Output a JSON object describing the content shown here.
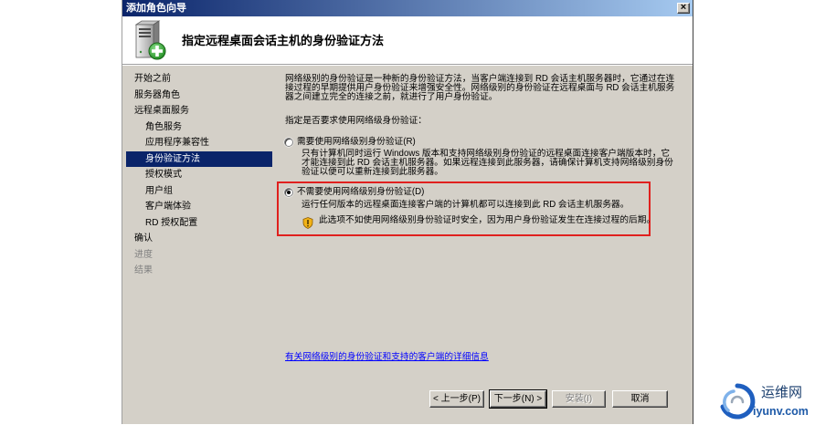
{
  "window": {
    "title": "添加角色向导",
    "close_glyph": "×"
  },
  "header": {
    "title": "指定远程桌面会话主机的身份验证方法",
    "icon": "server-add-icon"
  },
  "nav": {
    "items": [
      {
        "label": "开始之前",
        "level": 0,
        "selected": false,
        "enabled": true
      },
      {
        "label": "服务器角色",
        "level": 0,
        "selected": false,
        "enabled": true
      },
      {
        "label": "远程桌面服务",
        "level": 0,
        "selected": false,
        "enabled": true
      },
      {
        "label": "角色服务",
        "level": 1,
        "selected": false,
        "enabled": true
      },
      {
        "label": "应用程序兼容性",
        "level": 1,
        "selected": false,
        "enabled": true
      },
      {
        "label": "身份验证方法",
        "level": 1,
        "selected": true,
        "enabled": true
      },
      {
        "label": "授权模式",
        "level": 1,
        "selected": false,
        "enabled": true
      },
      {
        "label": "用户组",
        "level": 1,
        "selected": false,
        "enabled": true
      },
      {
        "label": "客户端体验",
        "level": 1,
        "selected": false,
        "enabled": true
      },
      {
        "label": "RD 授权配置",
        "level": 1,
        "selected": false,
        "enabled": true
      },
      {
        "label": "确认",
        "level": 0,
        "selected": false,
        "enabled": true
      },
      {
        "label": "进度",
        "level": 0,
        "selected": false,
        "enabled": false
      },
      {
        "label": "结果",
        "level": 0,
        "selected": false,
        "enabled": false
      }
    ]
  },
  "content": {
    "intro": "网络级别的身份验证是一种新的身份验证方法，当客户端连接到 RD 会话主机服务器时，它通过在连接过程的早期提供用户身份验证来增强安全性。网络级别的身份验证在远程桌面与 RD 会话主机服务器之间建立完全的连接之前，就进行了用户身份验证。",
    "prompt": "指定是否要求使用网络级身份验证：",
    "options": [
      {
        "label": "需要使用网络级别身份验证(R)",
        "description": "只有计算机同时运行 Windows 版本和支持网络级别身份验证的远程桌面连接客户端版本时，它才能连接到此 RD 会话主机服务器。如果远程连接到此服务器，请确保计算机支持网络级别身份验证以便可以重新连接到此服务器。",
        "checked": false,
        "highlighted": false
      },
      {
        "label": "不需要使用网络级别身份验证(D)",
        "description": "运行任何版本的远程桌面连接客户端的计算机都可以连接到此 RD 会话主机服务器。",
        "checked": true,
        "highlighted": true,
        "warning_icon": "shield-warning-icon",
        "warning": "此选项不如使用网络级别身份验证时安全，因为用户身份验证发生在连接过程的后期。"
      }
    ],
    "more_info_link": "有关网络级别的身份验证和支持的客户端的详细信息"
  },
  "buttons": {
    "back": {
      "label": "< 上一步(P)",
      "enabled": true,
      "default": false
    },
    "next": {
      "label": "下一步(N) >",
      "enabled": true,
      "default": true
    },
    "install": {
      "label": "安装(I)",
      "enabled": false,
      "default": false
    },
    "cancel": {
      "label": "取消",
      "enabled": true,
      "default": false
    }
  },
  "watermark": {
    "logo": "swirl-logo-icon",
    "name": "运维网",
    "site": "iyunv.com"
  },
  "colors": {
    "title_bar_start": "#0a246a",
    "title_bar_end": "#a6caf0",
    "selection": "#0a246a",
    "link": "#0000ff",
    "annotation_box": "#e0201e",
    "dialog_face": "#d4d0c8"
  }
}
